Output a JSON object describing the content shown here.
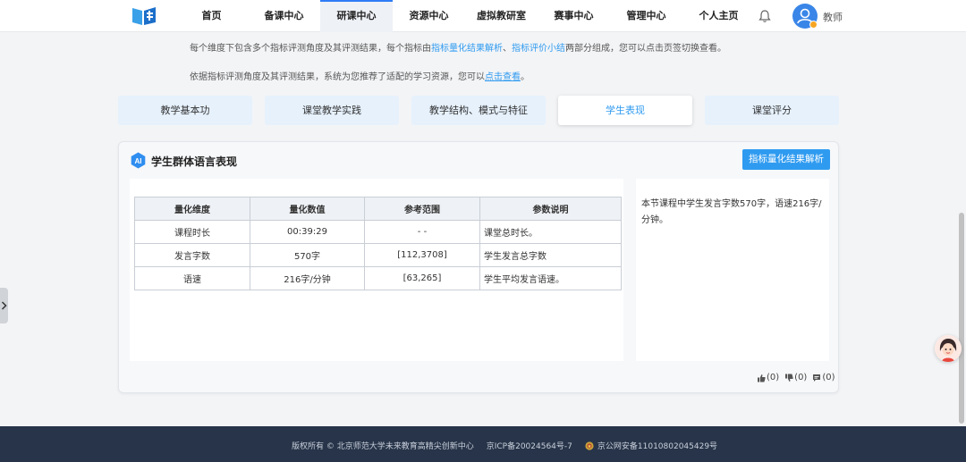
{
  "nav": {
    "items": [
      "首页",
      "备课中心",
      "研课中心",
      "资源中心",
      "虚拟教研室",
      "赛事中心",
      "管理中心",
      "个人主页"
    ],
    "active_index": 2,
    "user_name": "教师"
  },
  "intro": {
    "line1_prefix": "每个维度下包含多个指标评测角度及其评测结果，每个指标由",
    "line1_hl1": "指标量化结果解析",
    "line1_sep": "、",
    "line1_hl2": "指标评价小结",
    "line1_suffix": "两部分组成，您可以点击页签切换查看。",
    "line2_prefix": "依据指标评测角度及其评测结果，系统为您推荐了适配的学习资源，您可以",
    "line2_link": "点击查看",
    "line2_suffix": "。"
  },
  "tabs": [
    "教学基本功",
    "课堂教学实践",
    "教学结构、模式与特征",
    "学生表现",
    "课堂评分"
  ],
  "active_tab": "学生表现",
  "card": {
    "title": "学生群体语言表现",
    "analyze_button": "指标量化结果解析",
    "table": {
      "headers": [
        "量化维度",
        "量化数值",
        "参考范围",
        "参数说明"
      ],
      "rows": [
        [
          "课程时长",
          "00:39:29",
          "- -",
          "课堂总时长。"
        ],
        [
          "发言字数",
          "570字",
          "[112,3708]",
          "学生发言总字数"
        ],
        [
          "语速",
          "216字/分钟",
          "[63,265]",
          "学生平均发言语速。"
        ]
      ]
    },
    "summary": "本节课程中学生发言字数570字，语速216字/分钟。",
    "reactions": {
      "like": "(0)",
      "dislike": "(0)",
      "comment": "(0)"
    }
  },
  "footer": {
    "copyright": "版权所有 © 北京师范大学未来教育高精尖创新中心",
    "icp": "京ICP备20024564号-7",
    "police": "京公网安备11010802045429号"
  },
  "colors": {
    "accent": "#2f9bf0",
    "footer_bg": "#273449",
    "tab_bg": "#e6f1fc"
  }
}
